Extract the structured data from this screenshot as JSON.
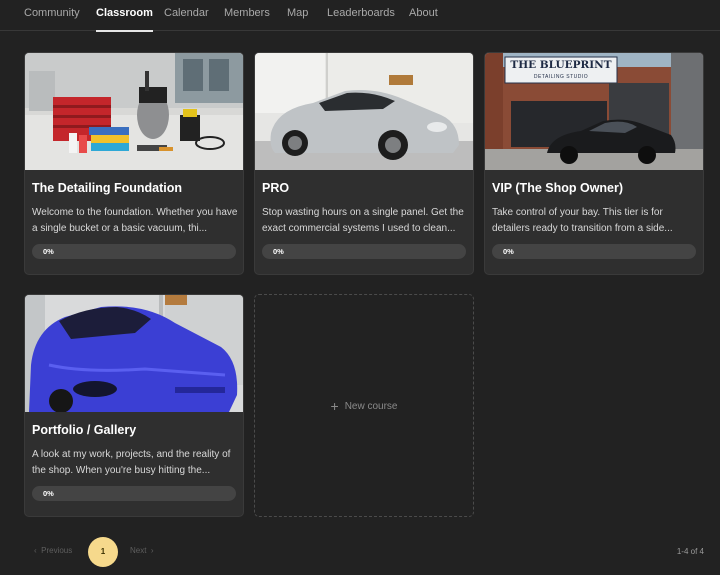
{
  "nav": {
    "tabs": [
      {
        "label": "Community"
      },
      {
        "label": "Classroom",
        "active": true
      },
      {
        "label": "Calendar"
      },
      {
        "label": "Members"
      },
      {
        "label": "Map"
      },
      {
        "label": "Leaderboards"
      },
      {
        "label": "About"
      }
    ]
  },
  "courses": [
    {
      "title": "The Detailing Foundation",
      "description": "Welcome to the foundation. Whether you have a single bucket or a basic vacuum, thi...",
      "progress": 0,
      "progress_label": "0%",
      "thumbnail": "detailing-tools-photo"
    },
    {
      "title": "PRO",
      "description": "Stop wasting hours on a single panel. Get the exact commercial systems I used to clean...",
      "progress": 0,
      "progress_label": "0%",
      "thumbnail": "silver-porsche-photo"
    },
    {
      "title": "VIP (The Shop Owner)",
      "description": "Take control of your bay. This tier is for detailers ready to transition from a side...",
      "progress": 0,
      "progress_label": "0%",
      "thumbnail": "blueprint-shop-storefront-photo",
      "sign_text": "THE BLUEPRINT",
      "sign_subtext": "DETAILING STUDIO"
    },
    {
      "title": "Portfolio / Gallery",
      "description": "A look at my work, projects, and the reality of the shop. When you're busy hitting the...",
      "progress": 0,
      "progress_label": "0%",
      "thumbnail": "blue-porsche-taycan-photo"
    }
  ],
  "new_course": {
    "label": "New course",
    "icon": "plus-icon"
  },
  "pagination": {
    "prev_label": "Previous",
    "next_label": "Next",
    "current_page": "1",
    "count_label": "1-4 of 4"
  },
  "colors": {
    "background": "#222222",
    "card": "#2f2f2f",
    "accent_page": "#f6d98c"
  }
}
